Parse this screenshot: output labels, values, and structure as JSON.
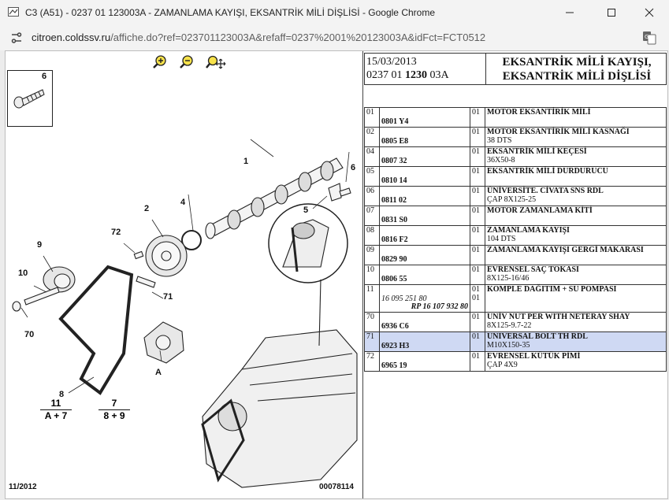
{
  "window": {
    "title": "C3 (A51) - 0237 01 123003A - ZAMANLAMA KAYIŞI, EKSANTRİK MİLİ DİŞLİSİ - Google Chrome"
  },
  "address": {
    "host": "citroen.coldssv.ru",
    "path": "/affiche.do?ref=023701123003A&refaff=0237%2001%20123003A&idFct=FCT0512"
  },
  "diagram": {
    "labels": [
      "6",
      "1",
      "6",
      "5",
      "4",
      "2",
      "72",
      "9",
      "10",
      "71",
      "70",
      "A",
      "8"
    ],
    "formula1_num": "11",
    "formula1_den": "A + 7",
    "formula2_num": "7",
    "formula2_den": "8 + 9",
    "date_code": "11/2012",
    "image_code": "00078114"
  },
  "header": {
    "date": "15/03/2013",
    "ref_part1": "0237 01 ",
    "ref_part2": "1230",
    "ref_part3": " 03A",
    "title_line1": "EKSANTRİK MİLİ KAYIŞI,",
    "title_line2": "EKSANTRİK MİLİ DİŞLİSİ"
  },
  "parts": [
    {
      "no": "01",
      "code": "0801 Y4",
      "qty": "01",
      "d1": "MOTOR EKSANTİRİK MİLİ",
      "d2": ""
    },
    {
      "no": "02",
      "code": "0805 E8",
      "qty": "01",
      "d1": "MOTOR EKSANTİRİK MİLİ KASNAĞI",
      "d2": "38 DTS"
    },
    {
      "no": "04",
      "code": "0807 32",
      "qty": "01",
      "d1": "EKSANTRİK MİLİ KEÇESİ",
      "d2": "36X50-8"
    },
    {
      "no": "05",
      "code": "0810 14",
      "qty": "01",
      "d1": "EKSANTRİK MİLİ DURDURUCU",
      "d2": ""
    },
    {
      "no": "06",
      "code": "0811 02",
      "qty": "01",
      "d1": "ÜNİVERSİTE. CİVATA SNS RDL",
      "d2": "ÇAP 8X125-25"
    },
    {
      "no": "07",
      "code": "0831 S0",
      "qty": "01",
      "d1": "MOTOR ZAMANLAMA KİTİ",
      "d2": ""
    },
    {
      "no": "08",
      "code": "0816 F2",
      "qty": "01",
      "d1": "ZAMANLAMA KAYIŞI",
      "d2": "104 DTS"
    },
    {
      "no": "09",
      "code": "0829 90",
      "qty": "01",
      "d1": "ZAMANLAMA KAYIŞI GERGİ MAKARASI",
      "d2": ""
    },
    {
      "no": "10",
      "code": "0806 55",
      "qty": "01",
      "d1": "EVRENSEL SAÇ TOKASI",
      "d2": "8X125-16/46"
    },
    {
      "no": "11",
      "code": "",
      "alt1": "16 095 251 80",
      "alt2": "RP 16 107 932 80",
      "qty": "01",
      "qty2": "01",
      "d1": "KOMPLE DAĞITIM + SU POMPASI",
      "d2": ""
    },
    {
      "no": "70",
      "code": "6936 C6",
      "qty": "01",
      "d1": "UNİV NUT PER WITH NETERAY SHAY",
      "d2": "8X125-9.7-22"
    },
    {
      "no": "71",
      "code": "6923 H3",
      "qty": "01",
      "d1": "UNIVERSAL BOLT TH RDL",
      "d2": "M10X150-35",
      "selected": true
    },
    {
      "no": "72",
      "code": "6965 19",
      "qty": "01",
      "d1": "EVRENSEL KÜTÜK PİMİ",
      "d2": "ÇAP 4X9"
    }
  ]
}
